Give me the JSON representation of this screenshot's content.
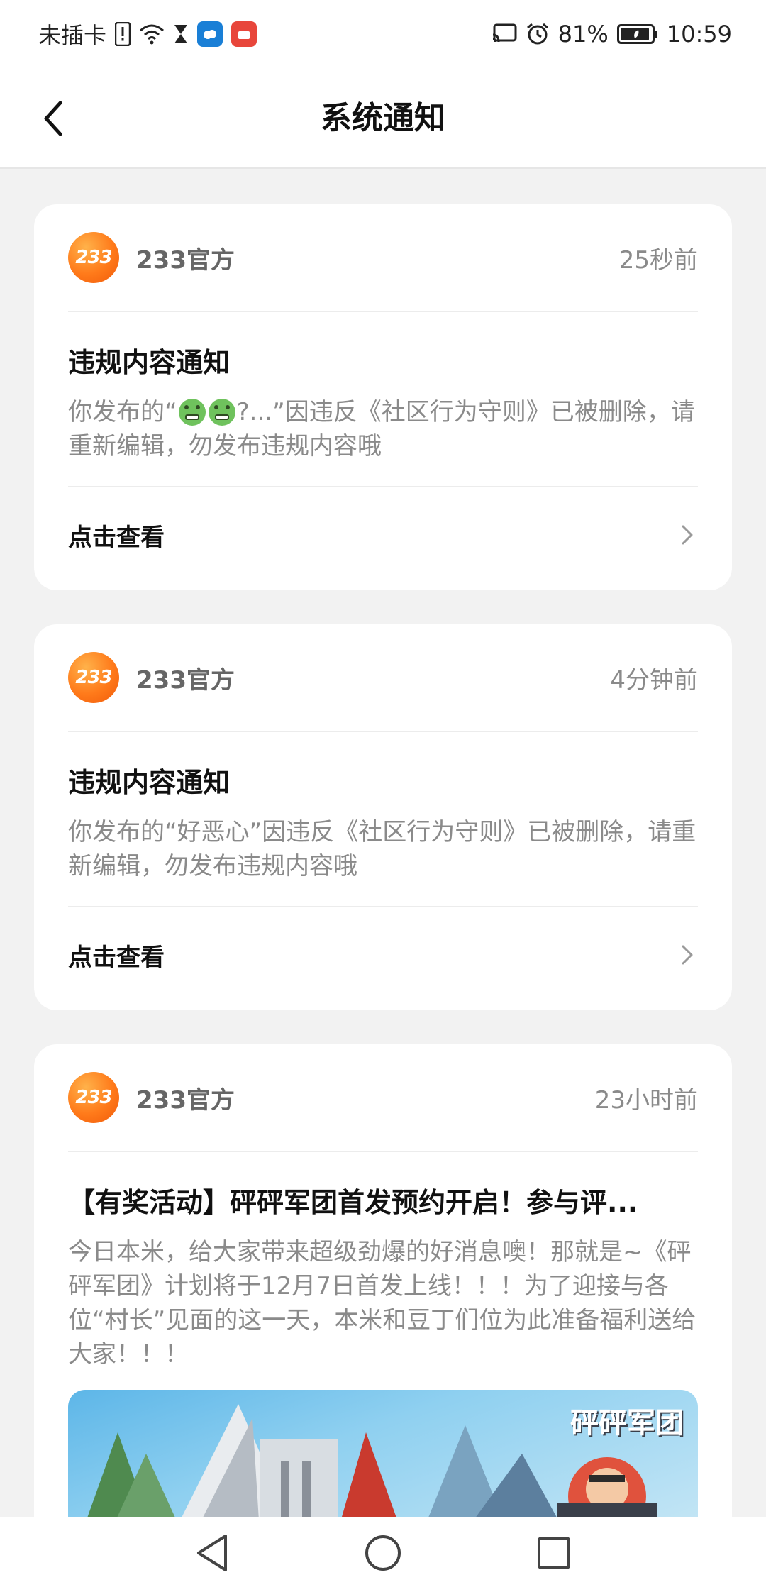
{
  "status_bar": {
    "carrier": "未插卡",
    "battery": "81%",
    "time": "10:59"
  },
  "header": {
    "title": "系统通知"
  },
  "notifications": [
    {
      "sender": "233官方",
      "logo_text": "233",
      "time": "25秒前",
      "title": "违规内容通知",
      "body_prefix": "你发布的“",
      "body_after_emoji": "?...”因违反《社区行为守则》已被删除，请重新编辑，勿发布违规内容哦",
      "action": "点击查看"
    },
    {
      "sender": "233官方",
      "logo_text": "233",
      "time": "4分钟前",
      "title": "违规内容通知",
      "body": "你发布的“好恶心”因违反《社区行为守则》已被删除，请重新编辑，勿发布违规内容哦",
      "action": "点击查看"
    },
    {
      "sender": "233官方",
      "logo_text": "233",
      "time": "23小时前",
      "title": "【有奖活动】砰砰军团首发预约开启！参与评...",
      "body": "今日本米，给大家带来超级劲爆的好消息噢！那就是~《砰砰军团》计划将于12月7日首发上线！！！为了迎接与各位“村长”见面的这一天，本米和豆丁们位为此准备福利送给大家！！！",
      "banner_text": "砰砰军团"
    }
  ],
  "colors": {
    "accent": "#ff7a1a",
    "background": "#f2f2f2"
  }
}
